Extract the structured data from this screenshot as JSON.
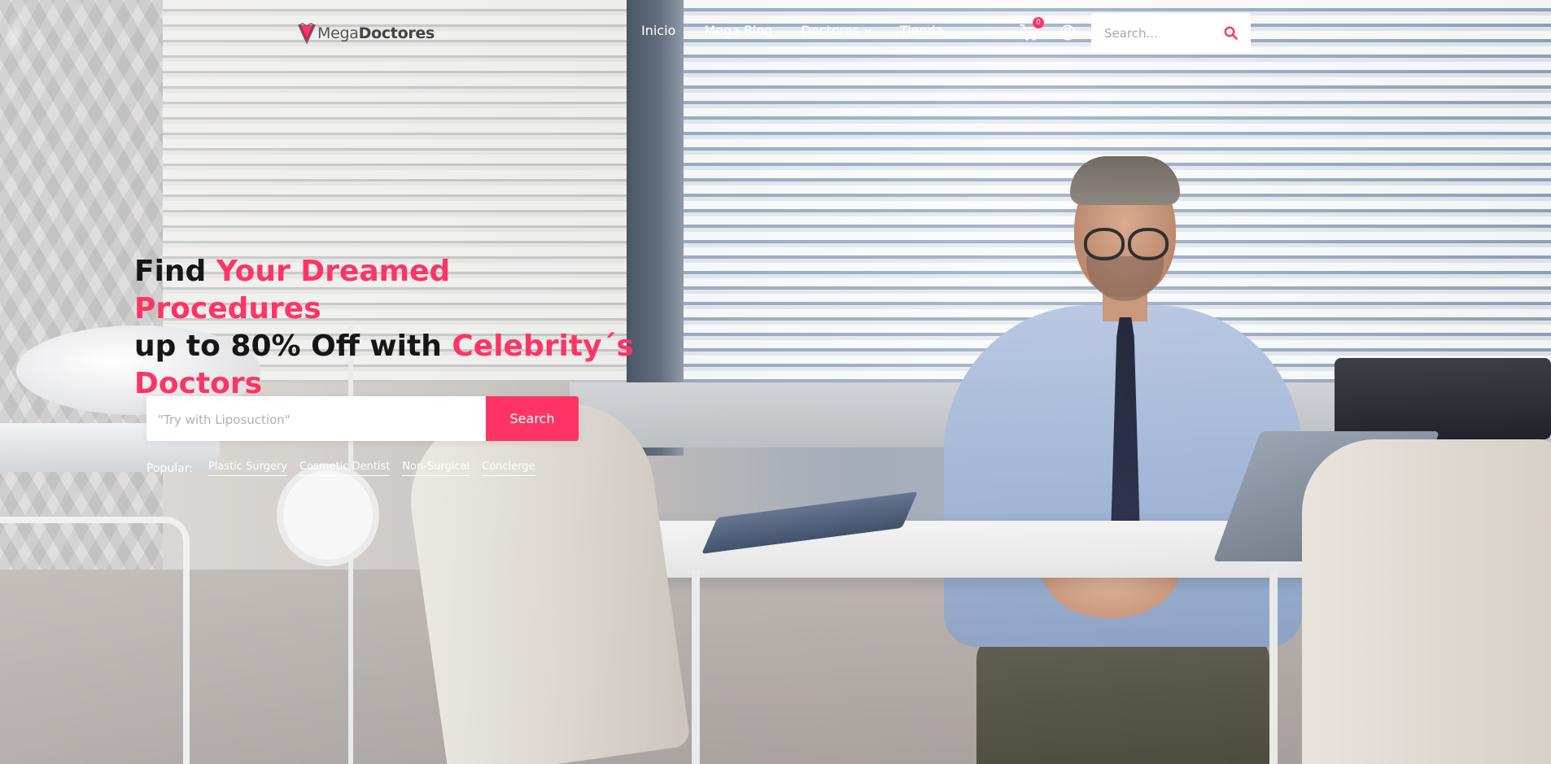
{
  "brand": {
    "name_light": "Mega",
    "name_bold": "Doctores",
    "accent_color": "#ff3464"
  },
  "nav": {
    "items": [
      {
        "label": "Inicio"
      },
      {
        "label": "Mega Blog"
      },
      {
        "label": "Doctores",
        "has_dropdown": true
      },
      {
        "label": "Tienda"
      }
    ]
  },
  "header": {
    "cart_icon": "cart-icon",
    "cart_count": "0",
    "account_icon": "user-circle-icon",
    "search": {
      "placeholder": "Search...",
      "icon": "search-icon"
    }
  },
  "hero": {
    "headline": {
      "part1": "Find ",
      "part2": "Your Dreamed Procedures",
      "part3": "up to 80% Off with ",
      "part4": "Celebrity´s Doctors"
    },
    "search": {
      "placeholder": "\"Try with Liposuction\"",
      "button_label": "Search"
    },
    "popular": {
      "label": "Popular:",
      "tags": [
        "Plastic Surgery",
        "Cosmetic Dentist",
        "Non-Surgical",
        "Concierge"
      ]
    }
  }
}
